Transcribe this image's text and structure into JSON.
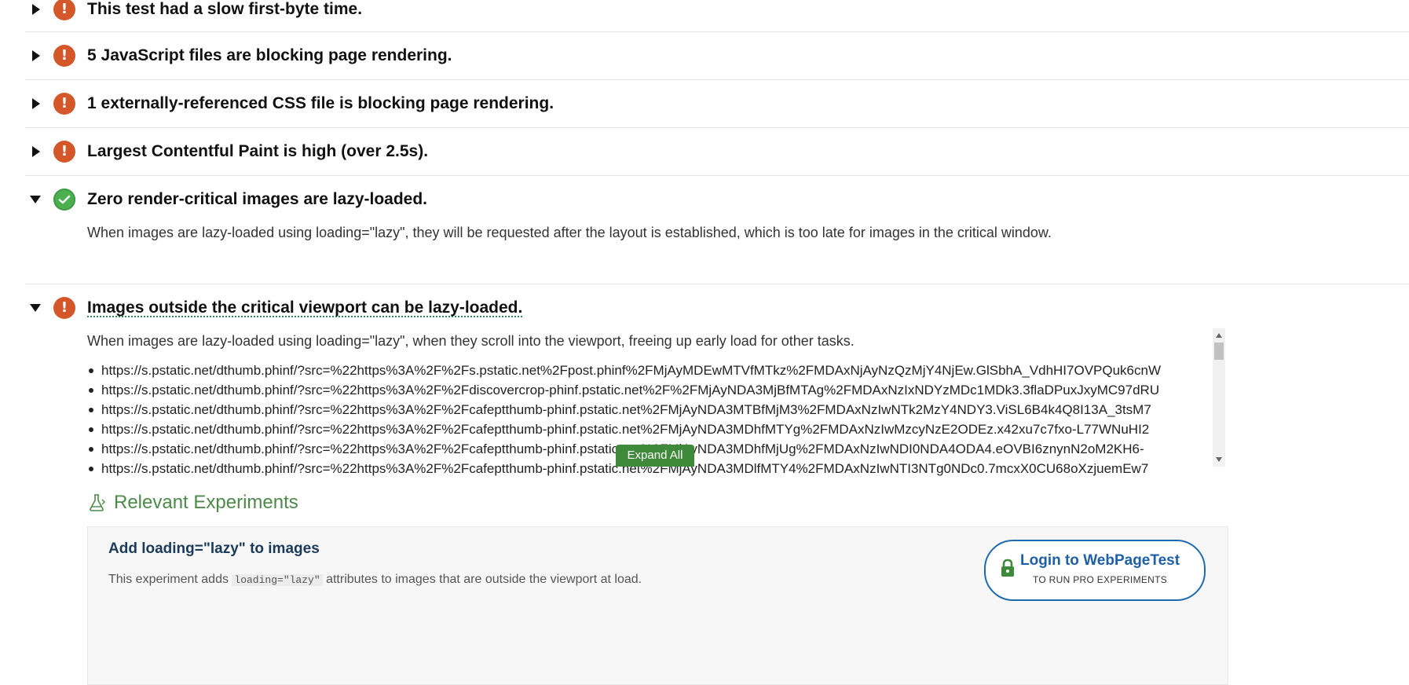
{
  "checks": [
    {
      "id": "slow-first-byte",
      "status": "bad",
      "expanded": false,
      "title": "This test had a slow first-byte time."
    },
    {
      "id": "blocking-js",
      "status": "bad",
      "expanded": false,
      "title": "5 JavaScript files are blocking page rendering."
    },
    {
      "id": "blocking-css",
      "status": "bad",
      "expanded": false,
      "title": "1 externally-referenced CSS file is blocking page rendering."
    },
    {
      "id": "lcp-high",
      "status": "bad",
      "expanded": false,
      "title": "Largest Contentful Paint is high (over 2.5s)."
    },
    {
      "id": "critical-lazy",
      "status": "good",
      "expanded": true,
      "title": "Zero render-critical images are lazy-loaded.",
      "description": "When images are lazy-loaded using loading=\"lazy\", they will be requested after the layout is established, which is too late for images in the critical window."
    },
    {
      "id": "offscreen-lazy",
      "status": "bad",
      "expanded": true,
      "title": "Images outside the critical viewport can be lazy-loaded.",
      "description": "When images are lazy-loaded using loading=\"lazy\", when they scroll into the viewport, freeing up early load for other tasks."
    }
  ],
  "urls": [
    "https://s.pstatic.net/dthumb.phinf/?src=%22https%3A%2F%2Fs.pstatic.net%2Fpost.phinf%2FMjAyMDEwMTVfMTkz%2FMDAxNjAyNzQzMjY4NjEw.GlSbhA_VdhHI7OVPQuk6cnW",
    "https://s.pstatic.net/dthumb.phinf/?src=%22https%3A%2F%2Fdiscovercrop-phinf.pstatic.net%2F%2FMjAyNDA3MjBfMTAg%2FMDAxNzIxNDYzMDc1MDk3.3flaDPuxJxyMC97dRU",
    "https://s.pstatic.net/dthumb.phinf/?src=%22https%3A%2F%2Fcafeptthumb-phinf.pstatic.net%2FMjAyNDA3MTBfMjM3%2FMDAxNzIwNTk2MzY4NDY3.ViSL6B4k4Q8I13A_3tsM7",
    "https://s.pstatic.net/dthumb.phinf/?src=%22https%3A%2F%2Fcafeptthumb-phinf.pstatic.net%2FMjAyNDA3MDhfMTYg%2FMDAxNzIwMzcyNzE2ODEz.x42xu7c7fxo-L77WNuHI2",
    "https://s.pstatic.net/dthumb.phinf/?src=%22https%3A%2F%2Fcafeptthumb-phinf.pstatic.net%2FMjAyNDA3MDhfMjUg%2FMDAxNzIwNDI0NDA4ODA4.eOVBI6znynN2oM2KH6-",
    "https://s.pstatic.net/dthumb.phinf/?src=%22https%3A%2F%2Fcafeptthumb-phinf.pstatic.net%2FMjAyNDA3MDlfMTY4%2FMDAxNzIwNTI3NTg0NDc0.7mcxX0CU68oXzjuemEw7"
  ],
  "expand_all_label": "Expand All",
  "experiments": {
    "heading": "Relevant Experiments",
    "card_title": "Add loading=\"lazy\" to images",
    "card_desc_before": "This experiment adds ",
    "card_desc_code": "loading=\"lazy\"",
    "card_desc_after": " attributes to images that are outside the viewport at load.",
    "login_main": "Login to WebPageTest",
    "login_sub": "TO RUN PRO EXPERIMENTS"
  },
  "colors": {
    "bad": "#d4572a",
    "good": "#4caf50",
    "accent_green": "#3f8a3a",
    "link_blue": "#1e5fa8"
  }
}
